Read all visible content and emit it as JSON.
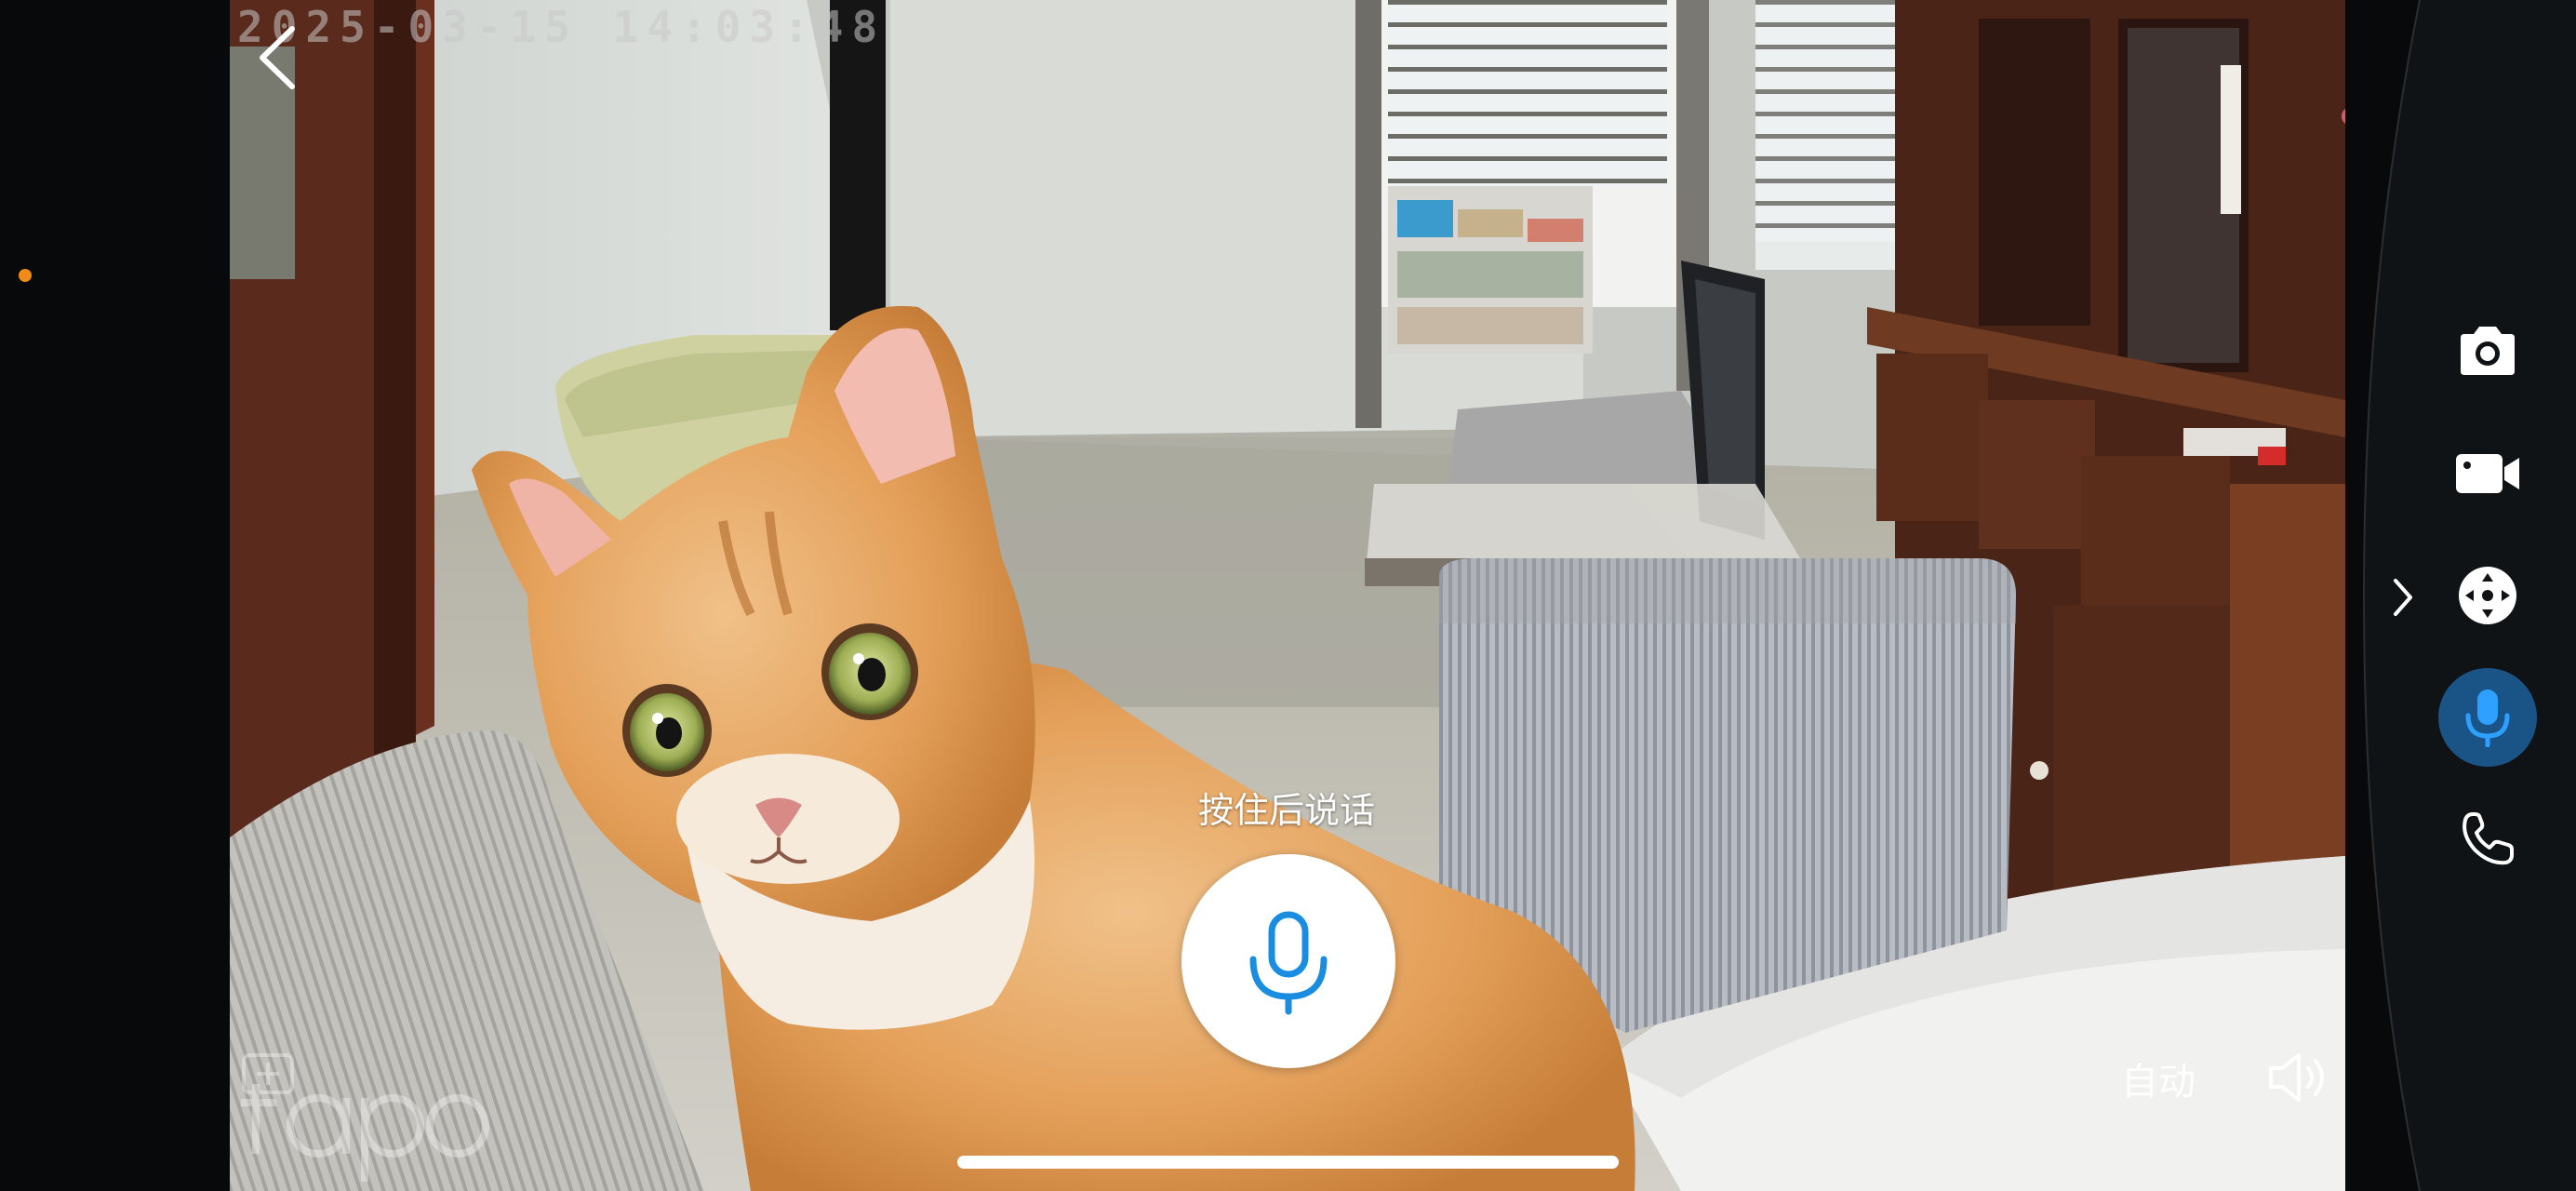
{
  "video": {
    "timestamp": "2025-03-15 14:03:48",
    "talk_hint": "按住后说话",
    "quality_label": "自动",
    "watermark_brand": "tapo"
  },
  "controls": {
    "back": "back-arrow-icon",
    "mic": "microphone-icon",
    "volume": "speaker-icon",
    "expand": "chevron-right-icon"
  },
  "side_buttons": [
    {
      "name": "screenshot",
      "icon": "camera-icon"
    },
    {
      "name": "record",
      "icon": "video-camera-icon"
    },
    {
      "name": "pan-tilt",
      "icon": "direction-pad-icon"
    },
    {
      "name": "talk",
      "icon": "microphone-icon",
      "active": true
    },
    {
      "name": "call",
      "icon": "phone-icon"
    }
  ],
  "colors": {
    "accent": "#1a8de0",
    "active_button_bg": "#1a5386",
    "status_dot": "#f28a17",
    "background": "#07090b"
  }
}
